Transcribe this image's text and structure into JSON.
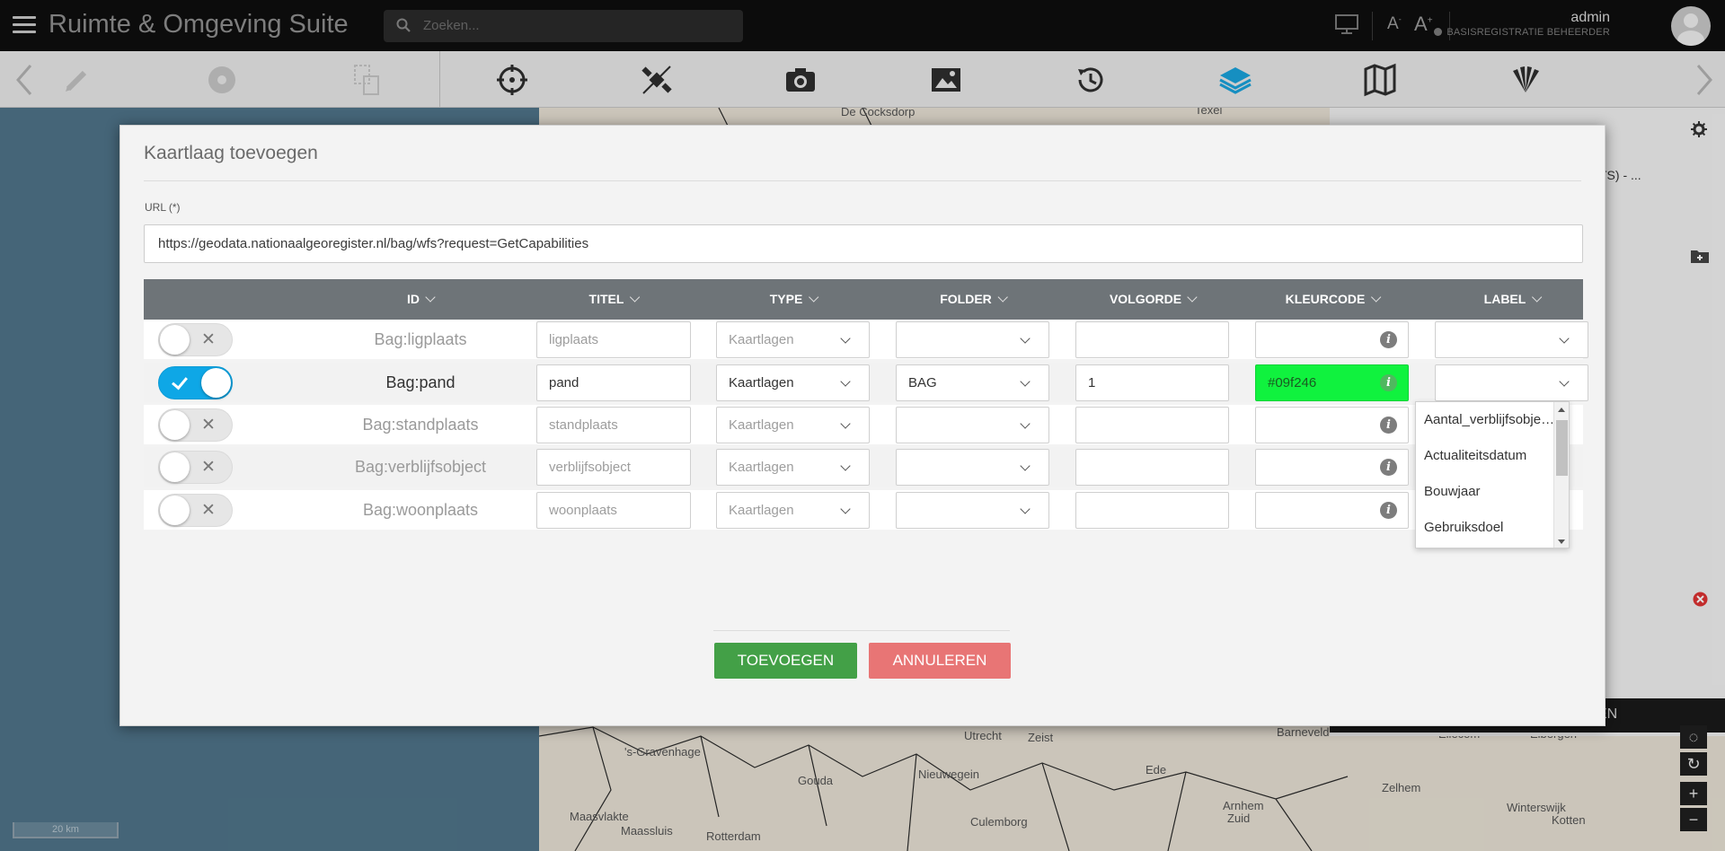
{
  "app": {
    "title": "Ruimte & Omgeving Suite",
    "search_placeholder": "Zoeken...",
    "font_decrease": "A",
    "font_increase": "A",
    "user_name": "admin",
    "user_role": "BASISREGISTRATIE BEHEERDER"
  },
  "toolbar": {
    "tools": [
      "pencil-icon",
      "disc-icon",
      "layers-copy-icon",
      "crosshair-icon",
      "satellite-icon",
      "camera-icon",
      "image-icon",
      "history-icon",
      "layers-icon",
      "map-icon",
      "fan-icon"
    ]
  },
  "map": {
    "scale_label": "20 km",
    "right_strip_text": "EN",
    "right_panel_text": "TS) - ...",
    "places": [
      "De Cocksdorp",
      "Texel",
      "Utrecht",
      "Zeist",
      "Barneveld",
      "Ede",
      "'s-Gravenhage",
      "Gouda",
      "Nieuwegein",
      "Maasvlakte",
      "Rotterdam",
      "Maassluis",
      "Culemborg",
      "Arnhem",
      "Zuid",
      "Zelhem",
      "Winterswijk",
      "Kotten",
      "Ellecom",
      "Eibergen",
      "Ede"
    ]
  },
  "modal": {
    "title": "Kaartlaag toevoegen",
    "url_label": "URL (*)",
    "url_value": "https://geodata.nationaalgeoregister.nl/bag/wfs?request=GetCapabilities",
    "columns": [
      "ID",
      "TITEL",
      "TYPE",
      "FOLDER",
      "VOLGORDE",
      "KLEURCODE",
      "LABEL"
    ],
    "rows": [
      {
        "enabled": false,
        "id": "Bag:ligplaats",
        "titel": "ligplaats",
        "type": "Kaartlagen",
        "folder": "",
        "volgorde": "",
        "kleurcode": "",
        "label": ""
      },
      {
        "enabled": true,
        "id": "Bag:pand",
        "titel": "pand",
        "type": "Kaartlagen",
        "folder": "BAG",
        "volgorde": "1",
        "kleurcode": "#09f246",
        "label": ""
      },
      {
        "enabled": false,
        "id": "Bag:standplaats",
        "titel": "standplaats",
        "type": "Kaartlagen",
        "folder": "",
        "volgorde": "",
        "kleurcode": "",
        "label": ""
      },
      {
        "enabled": false,
        "id": "Bag:verblijfsobject",
        "titel": "verblijfsobject",
        "type": "Kaartlagen",
        "folder": "",
        "volgorde": "",
        "kleurcode": "",
        "label": ""
      },
      {
        "enabled": false,
        "id": "Bag:woonplaats",
        "titel": "woonplaats",
        "type": "Kaartlagen",
        "folder": "",
        "volgorde": "",
        "kleurcode": "",
        "label": ""
      }
    ],
    "label_options": [
      "Aantal_verblijfsobjecten",
      "Actualiteitsdatum",
      "Bouwjaar",
      "Gebruiksdoel"
    ],
    "add_button": "TOEVOEGEN",
    "cancel_button": "ANNULEREN"
  },
  "colors": {
    "topbar": "#0e0e0e",
    "toggle_on": "#0ea7e6",
    "header": "#6e7478",
    "color_swatch": "#09f246",
    "add": "#43a047",
    "cancel": "#e87575",
    "active_tool": "#1aa3dc"
  }
}
